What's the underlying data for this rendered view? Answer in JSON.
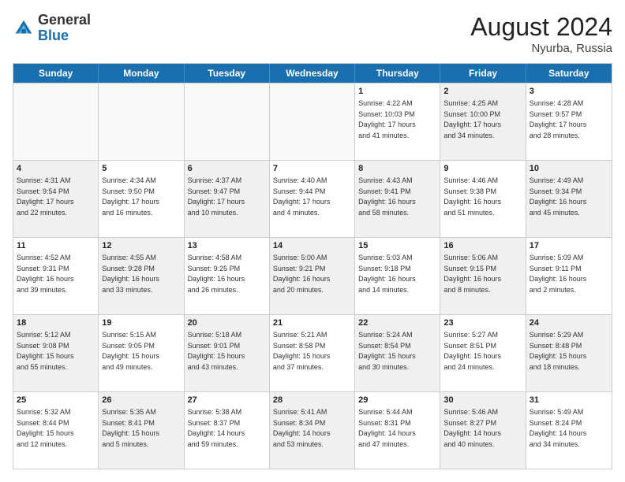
{
  "header": {
    "logo_general": "General",
    "logo_blue": "Blue",
    "month_year": "August 2024",
    "location": "Nyurba, Russia"
  },
  "days_of_week": [
    "Sunday",
    "Monday",
    "Tuesday",
    "Wednesday",
    "Thursday",
    "Friday",
    "Saturday"
  ],
  "rows": [
    [
      {
        "day": "",
        "info": "",
        "shaded": false,
        "empty": true
      },
      {
        "day": "",
        "info": "",
        "shaded": false,
        "empty": true
      },
      {
        "day": "",
        "info": "",
        "shaded": false,
        "empty": true
      },
      {
        "day": "",
        "info": "",
        "shaded": false,
        "empty": true
      },
      {
        "day": "1",
        "info": "Sunrise: 4:22 AM\nSunset: 10:03 PM\nDaylight: 17 hours\nand 41 minutes.",
        "shaded": false,
        "empty": false
      },
      {
        "day": "2",
        "info": "Sunrise: 4:25 AM\nSunset: 10:00 PM\nDaylight: 17 hours\nand 34 minutes.",
        "shaded": true,
        "empty": false
      },
      {
        "day": "3",
        "info": "Sunrise: 4:28 AM\nSunset: 9:57 PM\nDaylight: 17 hours\nand 28 minutes.",
        "shaded": false,
        "empty": false
      }
    ],
    [
      {
        "day": "4",
        "info": "Sunrise: 4:31 AM\nSunset: 9:54 PM\nDaylight: 17 hours\nand 22 minutes.",
        "shaded": true,
        "empty": false
      },
      {
        "day": "5",
        "info": "Sunrise: 4:34 AM\nSunset: 9:50 PM\nDaylight: 17 hours\nand 16 minutes.",
        "shaded": false,
        "empty": false
      },
      {
        "day": "6",
        "info": "Sunrise: 4:37 AM\nSunset: 9:47 PM\nDaylight: 17 hours\nand 10 minutes.",
        "shaded": true,
        "empty": false
      },
      {
        "day": "7",
        "info": "Sunrise: 4:40 AM\nSunset: 9:44 PM\nDaylight: 17 hours\nand 4 minutes.",
        "shaded": false,
        "empty": false
      },
      {
        "day": "8",
        "info": "Sunrise: 4:43 AM\nSunset: 9:41 PM\nDaylight: 16 hours\nand 58 minutes.",
        "shaded": true,
        "empty": false
      },
      {
        "day": "9",
        "info": "Sunrise: 4:46 AM\nSunset: 9:38 PM\nDaylight: 16 hours\nand 51 minutes.",
        "shaded": false,
        "empty": false
      },
      {
        "day": "10",
        "info": "Sunrise: 4:49 AM\nSunset: 9:34 PM\nDaylight: 16 hours\nand 45 minutes.",
        "shaded": true,
        "empty": false
      }
    ],
    [
      {
        "day": "11",
        "info": "Sunrise: 4:52 AM\nSunset: 9:31 PM\nDaylight: 16 hours\nand 39 minutes.",
        "shaded": false,
        "empty": false
      },
      {
        "day": "12",
        "info": "Sunrise: 4:55 AM\nSunset: 9:28 PM\nDaylight: 16 hours\nand 33 minutes.",
        "shaded": true,
        "empty": false
      },
      {
        "day": "13",
        "info": "Sunrise: 4:58 AM\nSunset: 9:25 PM\nDaylight: 16 hours\nand 26 minutes.",
        "shaded": false,
        "empty": false
      },
      {
        "day": "14",
        "info": "Sunrise: 5:00 AM\nSunset: 9:21 PM\nDaylight: 16 hours\nand 20 minutes.",
        "shaded": true,
        "empty": false
      },
      {
        "day": "15",
        "info": "Sunrise: 5:03 AM\nSunset: 9:18 PM\nDaylight: 16 hours\nand 14 minutes.",
        "shaded": false,
        "empty": false
      },
      {
        "day": "16",
        "info": "Sunrise: 5:06 AM\nSunset: 9:15 PM\nDaylight: 16 hours\nand 8 minutes.",
        "shaded": true,
        "empty": false
      },
      {
        "day": "17",
        "info": "Sunrise: 5:09 AM\nSunset: 9:11 PM\nDaylight: 16 hours\nand 2 minutes.",
        "shaded": false,
        "empty": false
      }
    ],
    [
      {
        "day": "18",
        "info": "Sunrise: 5:12 AM\nSunset: 9:08 PM\nDaylight: 15 hours\nand 55 minutes.",
        "shaded": true,
        "empty": false
      },
      {
        "day": "19",
        "info": "Sunrise: 5:15 AM\nSunset: 9:05 PM\nDaylight: 15 hours\nand 49 minutes.",
        "shaded": false,
        "empty": false
      },
      {
        "day": "20",
        "info": "Sunrise: 5:18 AM\nSunset: 9:01 PM\nDaylight: 15 hours\nand 43 minutes.",
        "shaded": true,
        "empty": false
      },
      {
        "day": "21",
        "info": "Sunrise: 5:21 AM\nSunset: 8:58 PM\nDaylight: 15 hours\nand 37 minutes.",
        "shaded": false,
        "empty": false
      },
      {
        "day": "22",
        "info": "Sunrise: 5:24 AM\nSunset: 8:54 PM\nDaylight: 15 hours\nand 30 minutes.",
        "shaded": true,
        "empty": false
      },
      {
        "day": "23",
        "info": "Sunrise: 5:27 AM\nSunset: 8:51 PM\nDaylight: 15 hours\nand 24 minutes.",
        "shaded": false,
        "empty": false
      },
      {
        "day": "24",
        "info": "Sunrise: 5:29 AM\nSunset: 8:48 PM\nDaylight: 15 hours\nand 18 minutes.",
        "shaded": true,
        "empty": false
      }
    ],
    [
      {
        "day": "25",
        "info": "Sunrise: 5:32 AM\nSunset: 8:44 PM\nDaylight: 15 hours\nand 12 minutes.",
        "shaded": false,
        "empty": false
      },
      {
        "day": "26",
        "info": "Sunrise: 5:35 AM\nSunset: 8:41 PM\nDaylight: 15 hours\nand 5 minutes.",
        "shaded": true,
        "empty": false
      },
      {
        "day": "27",
        "info": "Sunrise: 5:38 AM\nSunset: 8:37 PM\nDaylight: 14 hours\nand 59 minutes.",
        "shaded": false,
        "empty": false
      },
      {
        "day": "28",
        "info": "Sunrise: 5:41 AM\nSunset: 8:34 PM\nDaylight: 14 hours\nand 53 minutes.",
        "shaded": true,
        "empty": false
      },
      {
        "day": "29",
        "info": "Sunrise: 5:44 AM\nSunset: 8:31 PM\nDaylight: 14 hours\nand 47 minutes.",
        "shaded": false,
        "empty": false
      },
      {
        "day": "30",
        "info": "Sunrise: 5:46 AM\nSunset: 8:27 PM\nDaylight: 14 hours\nand 40 minutes.",
        "shaded": true,
        "empty": false
      },
      {
        "day": "31",
        "info": "Sunrise: 5:49 AM\nSunset: 8:24 PM\nDaylight: 14 hours\nand 34 minutes.",
        "shaded": false,
        "empty": false
      }
    ]
  ]
}
